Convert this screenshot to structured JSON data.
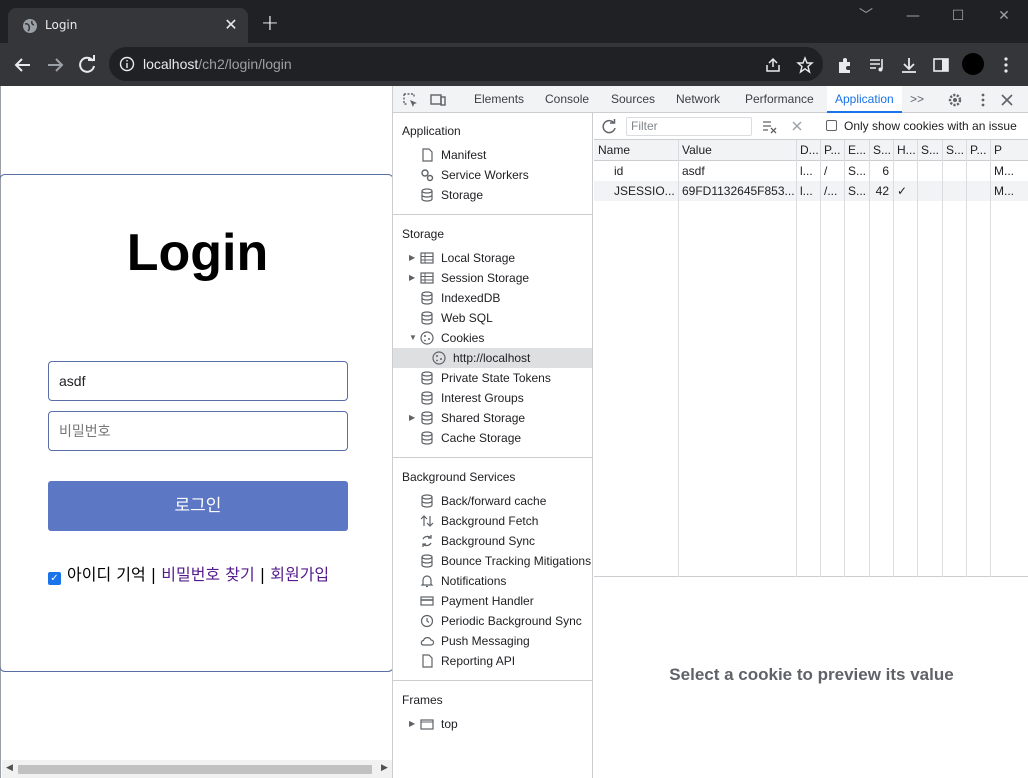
{
  "browser": {
    "tab_title": "Login",
    "tab_close": "✕",
    "new_tab": "+",
    "url_host": "localhost",
    "url_path": "/ch2/login/login",
    "window_controls": [
      "﹀",
      "—",
      "☐",
      "✕"
    ]
  },
  "page": {
    "title": "Login",
    "id_value": "asdf",
    "password_placeholder": "비밀번호",
    "login_button": "로그인",
    "remember_label": "아이디 기억",
    "separator": "|",
    "find_password": "비밀번호 찾기",
    "signup": "회원가입"
  },
  "devtools": {
    "tabs": [
      "Elements",
      "Console",
      "Sources",
      "Network",
      "Performance",
      "Application"
    ],
    "active_tab": "Application",
    "more_tabs": ">>",
    "sections": {
      "application": {
        "title": "Application",
        "items": [
          "Manifest",
          "Service Workers",
          "Storage"
        ]
      },
      "storage": {
        "title": "Storage",
        "items": [
          "Local Storage",
          "Session Storage",
          "IndexedDB",
          "Web SQL",
          "Cookies",
          "http://localhost",
          "Private State Tokens",
          "Interest Groups",
          "Shared Storage",
          "Cache Storage"
        ]
      },
      "background": {
        "title": "Background Services",
        "items": [
          "Back/forward cache",
          "Background Fetch",
          "Background Sync",
          "Bounce Tracking Mitigations",
          "Notifications",
          "Payment Handler",
          "Periodic Background Sync",
          "Push Messaging",
          "Reporting API"
        ]
      },
      "frames": {
        "title": "Frames",
        "items": [
          "top"
        ]
      }
    },
    "filter_placeholder": "Filter",
    "only_issues_label": "Only show cookies with an issue",
    "columns": [
      "Name",
      "Value",
      "D...",
      "P...",
      "E...",
      "S...",
      "H...",
      "S...",
      "S...",
      "P...",
      "P"
    ],
    "rows": [
      [
        "id",
        "asdf",
        "l...",
        "/",
        "S...",
        "6",
        "",
        "",
        "",
        "",
        "M..."
      ],
      [
        "JSESSIO...",
        "69FD1132645F853...",
        "l...",
        "/...",
        "S...",
        "42",
        "✓",
        "",
        "",
        "",
        "M..."
      ]
    ],
    "preview_message": "Select a cookie to preview its value"
  }
}
